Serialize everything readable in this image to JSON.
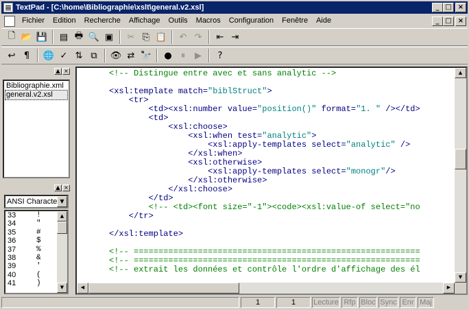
{
  "window": {
    "title": "TextPad - [C:\\home\\Bibliographie\\xslt\\general.v2.xsl]",
    "min_glyph": "_",
    "max_glyph": "□",
    "close_glyph": "×"
  },
  "menu": [
    "Fichier",
    "Edition",
    "Recherche",
    "Affichage",
    "Outils",
    "Macros",
    "Configuration",
    "Fenêtre",
    "Aide"
  ],
  "toolbar1": [
    {
      "name": "new-icon",
      "glyph": "🗋",
      "enabled": true
    },
    {
      "name": "open-icon",
      "glyph": "📂",
      "enabled": true
    },
    {
      "name": "save-icon",
      "glyph": "💾",
      "enabled": false
    },
    {
      "sep": true
    },
    {
      "name": "save-all-icon",
      "glyph": "▤",
      "enabled": true
    },
    {
      "name": "print-icon",
      "glyph": "🖶",
      "enabled": true
    },
    {
      "name": "print-preview-icon",
      "glyph": "🔍",
      "enabled": true
    },
    {
      "name": "document-properties-icon",
      "glyph": "▣",
      "enabled": true
    },
    {
      "sep": true
    },
    {
      "name": "cut-icon",
      "glyph": "✂",
      "enabled": false
    },
    {
      "name": "copy-icon",
      "glyph": "⎘",
      "enabled": true
    },
    {
      "name": "paste-icon",
      "glyph": "📋",
      "enabled": true
    },
    {
      "sep": true
    },
    {
      "name": "undo-icon",
      "glyph": "↶",
      "enabled": false
    },
    {
      "name": "redo-icon",
      "glyph": "↷",
      "enabled": false
    },
    {
      "sep": true
    },
    {
      "name": "unindent-icon",
      "glyph": "⇤",
      "enabled": true
    },
    {
      "name": "indent-icon",
      "glyph": "⇥",
      "enabled": true
    }
  ],
  "toolbar2": [
    {
      "name": "word-wrap-icon",
      "glyph": "↩",
      "enabled": true
    },
    {
      "name": "pilcrow-icon",
      "glyph": "¶",
      "enabled": true
    },
    {
      "sep": true
    },
    {
      "name": "web-browser-icon",
      "glyph": "🌐",
      "enabled": true
    },
    {
      "name": "spelling-icon",
      "glyph": "✓",
      "enabled": true
    },
    {
      "name": "sort-icon",
      "glyph": "⇅",
      "enabled": true
    },
    {
      "name": "compare-files-icon",
      "glyph": "⧉",
      "enabled": true
    },
    {
      "sep": true
    },
    {
      "name": "find-in-files-icon",
      "glyph": "👁",
      "enabled": true
    },
    {
      "name": "replace-icon",
      "glyph": "⇄",
      "enabled": true
    },
    {
      "name": "find-next-icon",
      "glyph": "🔭",
      "enabled": true
    },
    {
      "sep": true
    },
    {
      "name": "record-macro-icon",
      "glyph": "●",
      "enabled": true
    },
    {
      "name": "pause-macro-icon",
      "glyph": "⏸",
      "enabled": false
    },
    {
      "name": "play-macro-icon",
      "glyph": "▶",
      "enabled": false
    },
    {
      "sep": true
    },
    {
      "name": "context-help-icon",
      "glyph": "?",
      "enabled": true
    }
  ],
  "documents": [
    "Bibliographie.xml",
    "general.v2.xsl"
  ],
  "clipLibrary": {
    "selected": "ANSI Characters",
    "rows": [
      {
        "code": "33",
        "char": "!"
      },
      {
        "code": "34",
        "char": "\""
      },
      {
        "code": "35",
        "char": "#"
      },
      {
        "code": "36",
        "char": "$"
      },
      {
        "code": "37",
        "char": "%"
      },
      {
        "code": "38",
        "char": "&"
      },
      {
        "code": "39",
        "char": "'"
      },
      {
        "code": "40",
        "char": "("
      },
      {
        "code": "41",
        "char": ")"
      }
    ]
  },
  "code_lines": [
    [
      [
        "c",
        "<!-- Distingue entre avec et sans analytic -->"
      ]
    ],
    [],
    [
      [
        "t",
        "<xsl:template match="
      ],
      [
        "s",
        "\"biblStruct\""
      ],
      [
        "t",
        ">"
      ]
    ],
    [
      [
        "t",
        "    <tr>"
      ]
    ],
    [
      [
        "t",
        "        <td><xsl:number value="
      ],
      [
        "s",
        "\"position()\""
      ],
      [
        "t",
        " format="
      ],
      [
        "s",
        "\"1. \""
      ],
      [
        "t",
        " /></td>"
      ]
    ],
    [
      [
        "t",
        "        <td>"
      ]
    ],
    [
      [
        "t",
        "            <xsl:choose>"
      ]
    ],
    [
      [
        "t",
        "                <xsl:when test="
      ],
      [
        "s",
        "\"analytic\""
      ],
      [
        "t",
        ">"
      ]
    ],
    [
      [
        "t",
        "                    <xsl:apply-templates select="
      ],
      [
        "s",
        "\"analytic\""
      ],
      [
        "t",
        " />"
      ]
    ],
    [
      [
        "t",
        "                </xsl:when>"
      ]
    ],
    [
      [
        "t",
        "                <xsl:otherwise>"
      ]
    ],
    [
      [
        "t",
        "                    <xsl:apply-templates select="
      ],
      [
        "s",
        "\"monogr\""
      ],
      [
        "t",
        "/>"
      ]
    ],
    [
      [
        "t",
        "                </xsl:otherwise>"
      ]
    ],
    [
      [
        "t",
        "            </xsl:choose>"
      ]
    ],
    [
      [
        "t",
        "        </td>"
      ]
    ],
    [
      [
        "c",
        "        <!-- <td><font size=\"-1\"><code><xsl:value-of select=\"no"
      ]
    ],
    [
      [
        "t",
        "    </tr>"
      ]
    ],
    [],
    [
      [
        "t",
        "</xsl:template>"
      ]
    ],
    [],
    [
      [
        "c",
        "<!-- =========================================================="
      ]
    ],
    [
      [
        "c",
        "<!-- =========================================================="
      ]
    ],
    [
      [
        "c",
        "<!-- extrait les données et contrôle l'ordre d'affichage des él"
      ]
    ]
  ],
  "status": {
    "line": "1",
    "col": "1",
    "flags": [
      "Lecture",
      "Rfp",
      "Bloc",
      "Sync",
      "Enr",
      "Maj"
    ]
  }
}
